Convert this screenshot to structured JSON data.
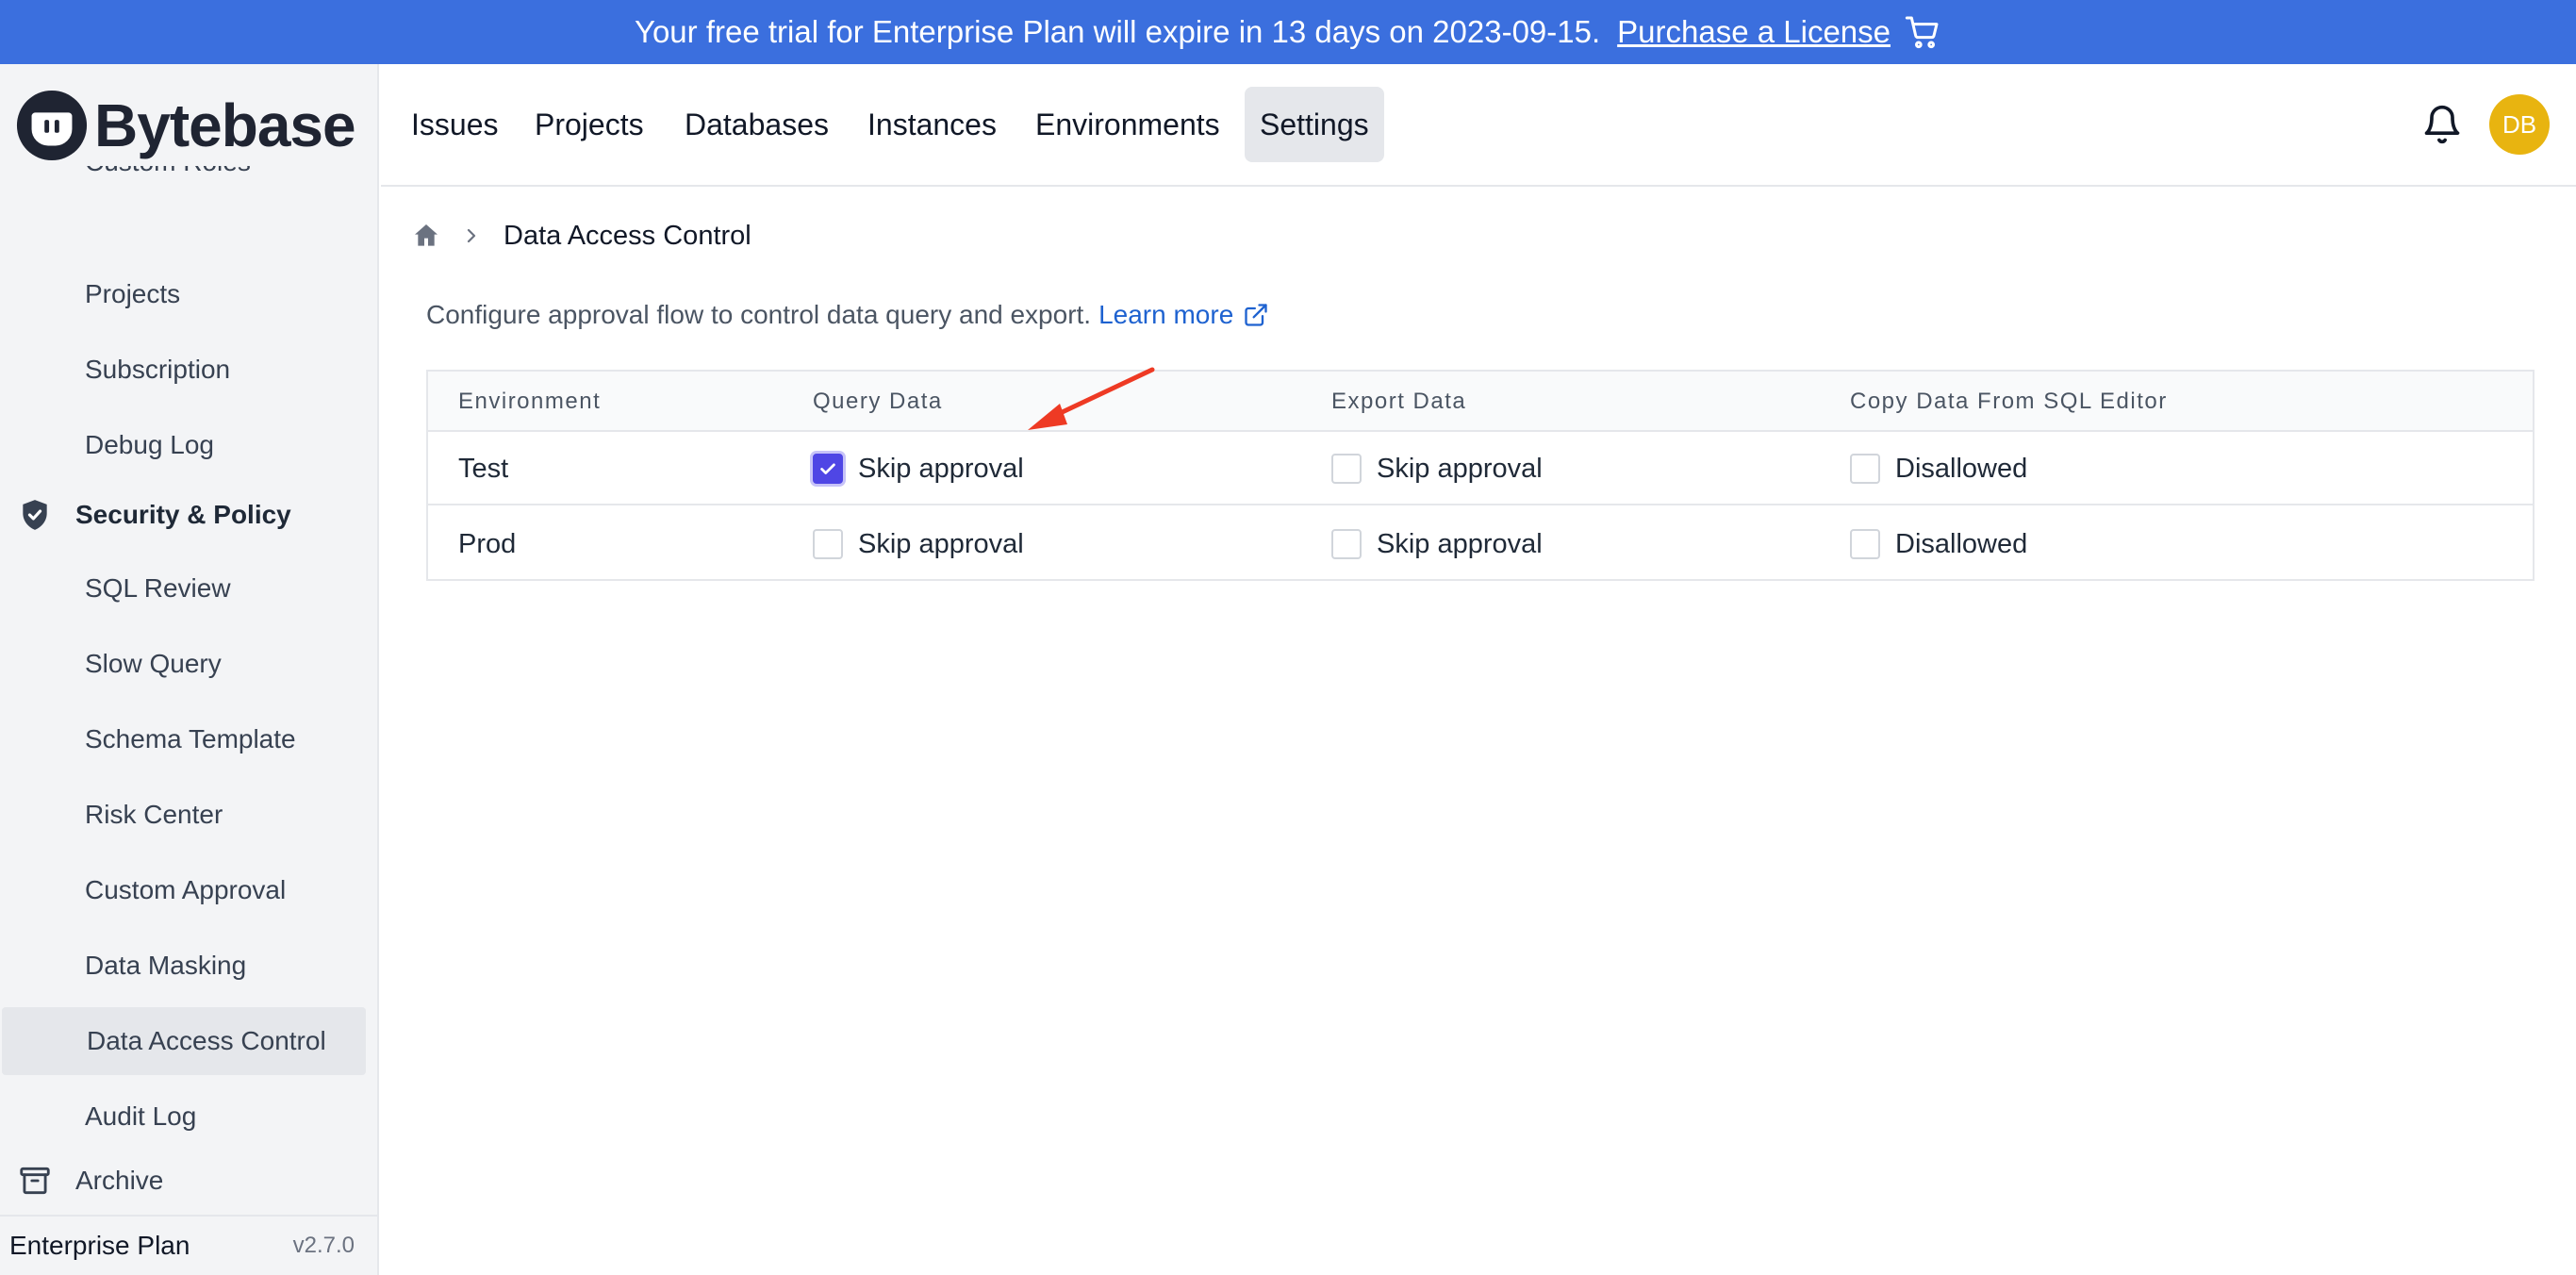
{
  "banner": {
    "message": "Your free trial for Enterprise Plan will expire in 13 days on 2023-09-15.",
    "link": "Purchase a License"
  },
  "brand": {
    "name": "Bytebase"
  },
  "topnav": {
    "tabs": [
      "Issues",
      "Projects",
      "Databases",
      "Instances",
      "Environments",
      "Settings"
    ],
    "active": "Settings",
    "avatar_initials": "DB"
  },
  "sidebar": {
    "clipped_item": "Custom Roles",
    "items_top": [
      "Projects",
      "Subscription",
      "Debug Log"
    ],
    "section": "Security & Policy",
    "items": [
      "SQL Review",
      "Slow Query",
      "Schema Template",
      "Risk Center",
      "Custom Approval",
      "Data Masking",
      "Data Access Control",
      "Audit Log"
    ],
    "active": "Data Access Control",
    "archive": "Archive",
    "plan": "Enterprise Plan",
    "version": "v2.7.0"
  },
  "breadcrumb": {
    "current": "Data Access Control"
  },
  "description": {
    "text": "Configure approval flow to control data query and export.",
    "link": "Learn more"
  },
  "table": {
    "headers": [
      "Environment",
      "Query Data",
      "Export Data",
      "Copy Data From SQL Editor"
    ],
    "rows": [
      {
        "env": "Test",
        "query": "Skip approval",
        "query_checked": true,
        "export": "Skip approval",
        "export_checked": false,
        "copy": "Disallowed",
        "copy_checked": false
      },
      {
        "env": "Prod",
        "query": "Skip approval",
        "query_checked": false,
        "export": "Skip approval",
        "export_checked": false,
        "copy": "Disallowed",
        "copy_checked": false
      }
    ]
  },
  "colors": {
    "banner": "#3b6fde",
    "accent": "#4f46e5",
    "avatar": "#e8b410",
    "annotation_arrow": "#ee3a24"
  }
}
